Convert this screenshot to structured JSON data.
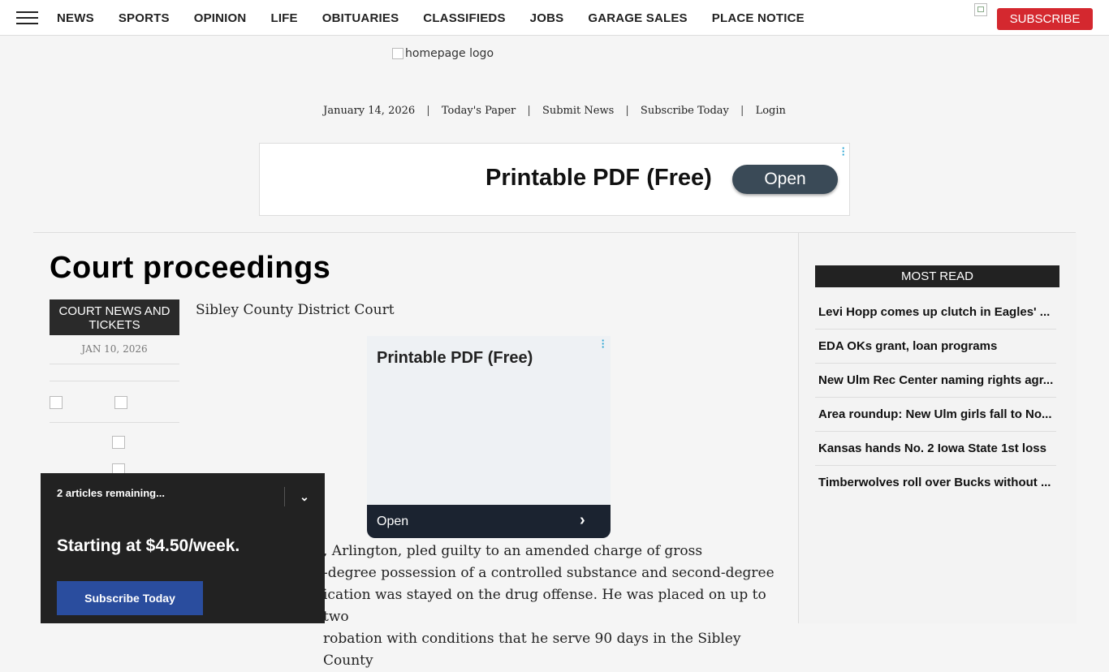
{
  "nav": {
    "items": [
      "NEWS",
      "SPORTS",
      "OPINION",
      "LIFE",
      "OBITUARIES",
      "CLASSIFIEDS",
      "JOBS",
      "GARAGE SALES",
      "PLACE NOTICE"
    ],
    "subscribe_label": "SUBSCRIBE",
    "menu_icon": "hamburger-icon"
  },
  "header": {
    "logo_alt": "homepage logo",
    "date": "January 14, 2026",
    "links": [
      "Today's Paper",
      "Submit News",
      "Subscribe Today",
      "Login"
    ],
    "separator": "|"
  },
  "ad_top": {
    "text": "Printable PDF (Free)",
    "button": "Open",
    "dots_color": "#1a9ecf"
  },
  "article": {
    "title": "Court proceedings",
    "category": "COURT NEWS AND TICKETS",
    "date": "JAN 10, 2026",
    "subhead": "Sibley County District Court",
    "body_lines": [
      ", Arlington, pled guilty to an amended charge of gross",
      "-degree possession of a controlled substance and second-degree",
      "ication was stayed on the drug offense. He was placed on up to two",
      "robation with conditions that he serve 90 days in the Sibley County"
    ]
  },
  "ad_mid": {
    "text": "Printable PDF (Free)",
    "button": "Open",
    "chevron": "›"
  },
  "most_read": {
    "title": "MOST READ",
    "items": [
      "Levi Hopp comes up clutch in Eagles' ...",
      "EDA OKs grant, loan programs",
      "New Ulm Rec Center naming rights agr...",
      "Area roundup: New Ulm girls fall to No...",
      "Kansas hands No. 2 Iowa State 1st loss",
      "Timberwolves roll over Bucks without ..."
    ]
  },
  "paywall": {
    "remaining": "2 articles remaining...",
    "price": "Starting at $4.50/week.",
    "button": "Subscribe Today",
    "collapse_icon": "chevron-down-icon"
  },
  "colors": {
    "subscribe": "#d4282f",
    "paywall_bg": "#222222",
    "paywall_button": "#2a4d9e",
    "ad_button": "#3a4a57"
  }
}
